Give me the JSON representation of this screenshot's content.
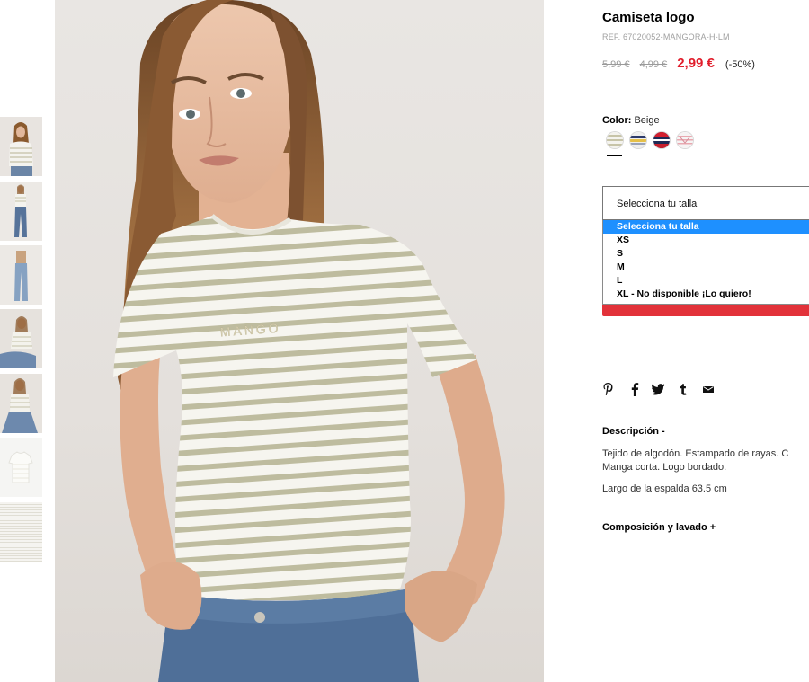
{
  "product": {
    "title": "Camiseta logo",
    "ref": "REF. 67020052-MANGORA-H-LM",
    "price_original": "5,99 €",
    "price_previous": "4,99 €",
    "price_current": "2,99 €",
    "discount": "(-50%)",
    "photo_logo_text": "MANGO"
  },
  "color": {
    "label": "Color:",
    "value": "Beige",
    "swatches": [
      "beige-stripes",
      "navy-yellow-stripes",
      "red-navy-stripes",
      "white-pink-stripes"
    ],
    "selected_index": 0
  },
  "size": {
    "placeholder": "Selecciona tu talla",
    "options": [
      "Selecciona tu talla",
      "XS",
      "S",
      "M",
      "L",
      "XL - No disponible ¡Lo quiero!"
    ],
    "selected_index": 0,
    "highlight_color": "#1e90ff",
    "button_color": "#e2323a"
  },
  "share": {
    "icons": [
      "pinterest-icon",
      "facebook-icon",
      "twitter-icon",
      "tumblr-icon",
      "email-icon"
    ]
  },
  "description": {
    "heading": "Descripción -",
    "line1": "Tejido de algodón. Estampado de rayas. C",
    "line2": "Manga corta. Logo bordado.",
    "line3": "Largo de la espalda 63.5 cm"
  },
  "composition": {
    "heading": "Composición y lavado +"
  },
  "colors": {
    "price_sale": "#e11d2b",
    "stripe": "#b9b79c"
  }
}
